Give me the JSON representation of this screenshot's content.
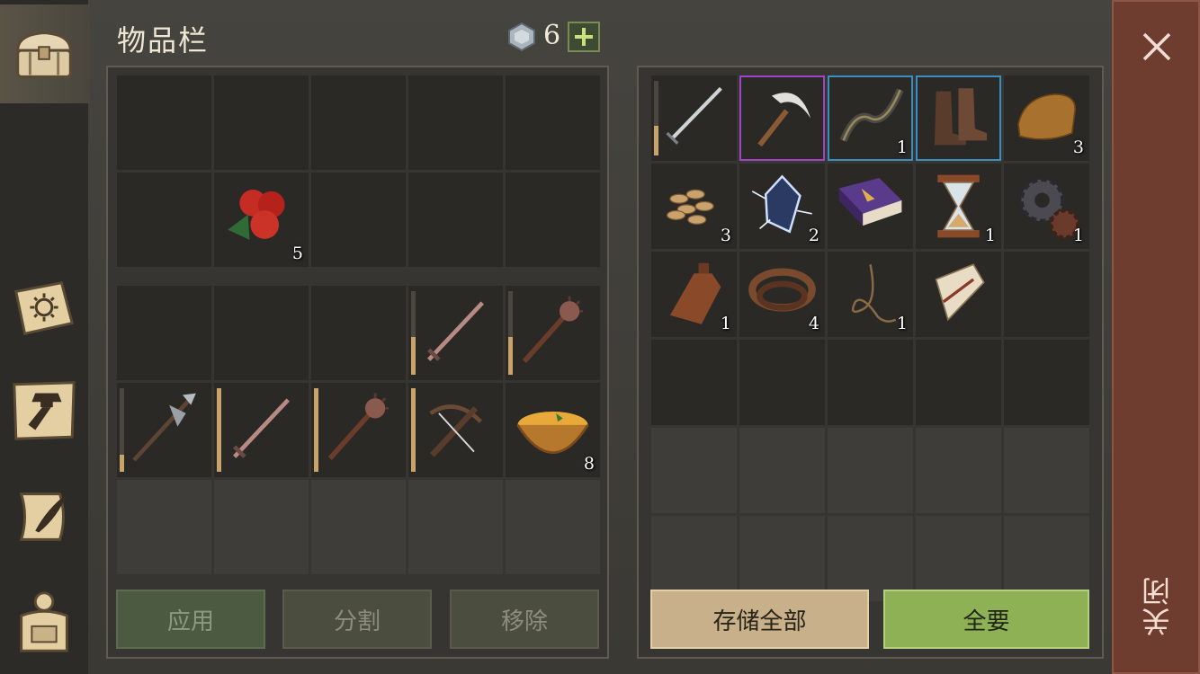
{
  "header": {
    "title": "物品栏",
    "currency_icon": "silver-gem-icon",
    "currency_count": "6",
    "add_icon": "plus-icon"
  },
  "tabs": [
    {
      "name": "chest",
      "icon": "chest-icon",
      "active": true
    },
    {
      "name": "journal",
      "icon": "sun-book-icon",
      "active": false
    },
    {
      "name": "crafting",
      "icon": "hammer-icon",
      "active": false
    },
    {
      "name": "quests",
      "icon": "scroll-quill-icon",
      "active": false
    },
    {
      "name": "character",
      "icon": "backpack-icon",
      "active": false
    }
  ],
  "left_top": [
    {},
    {},
    {},
    {},
    {},
    {},
    {
      "item": "berries",
      "count": "5"
    },
    {},
    {},
    {}
  ],
  "left_bottom": [
    {},
    {},
    {},
    {
      "item": "sword",
      "durability": 0.45
    },
    {
      "item": "mace",
      "durability": 0.45
    },
    {
      "item": "halberd",
      "durability": 0.2
    },
    {
      "item": "sword",
      "durability": 1.0
    },
    {
      "item": "mace",
      "durability": 1.0
    },
    {
      "item": "crossbow",
      "durability": 1.0
    },
    {
      "item": "soup",
      "count": "8"
    },
    {},
    {},
    {},
    {},
    {}
  ],
  "right_grid": [
    {
      "item": "longsword",
      "durability": 0.4
    },
    {
      "item": "scythe",
      "rarity": "purple"
    },
    {
      "item": "bow",
      "count": "1",
      "rarity": "blue"
    },
    {
      "item": "boots",
      "rarity": "blue"
    },
    {
      "item": "bread",
      "count": "3"
    },
    {
      "item": "seeds",
      "count": "3"
    },
    {
      "item": "crystal",
      "count": "2"
    },
    {
      "item": "spellbook"
    },
    {
      "item": "hourglass",
      "count": "1"
    },
    {
      "item": "gears",
      "count": "1"
    },
    {
      "item": "bottle",
      "count": "1"
    },
    {
      "item": "leather",
      "count": "4"
    },
    {
      "item": "rope",
      "count": "1"
    },
    {
      "item": "scroll"
    },
    {},
    {},
    {},
    {},
    {},
    {},
    {},
    {},
    {},
    {},
    {},
    {},
    {},
    {},
    {},
    {}
  ],
  "buttons": {
    "use": "应用",
    "split": "分割",
    "remove": "移除",
    "store_all": "存储全部",
    "take_all": "全要"
  },
  "close": {
    "label": "关闭",
    "icon": "close-x-icon"
  }
}
